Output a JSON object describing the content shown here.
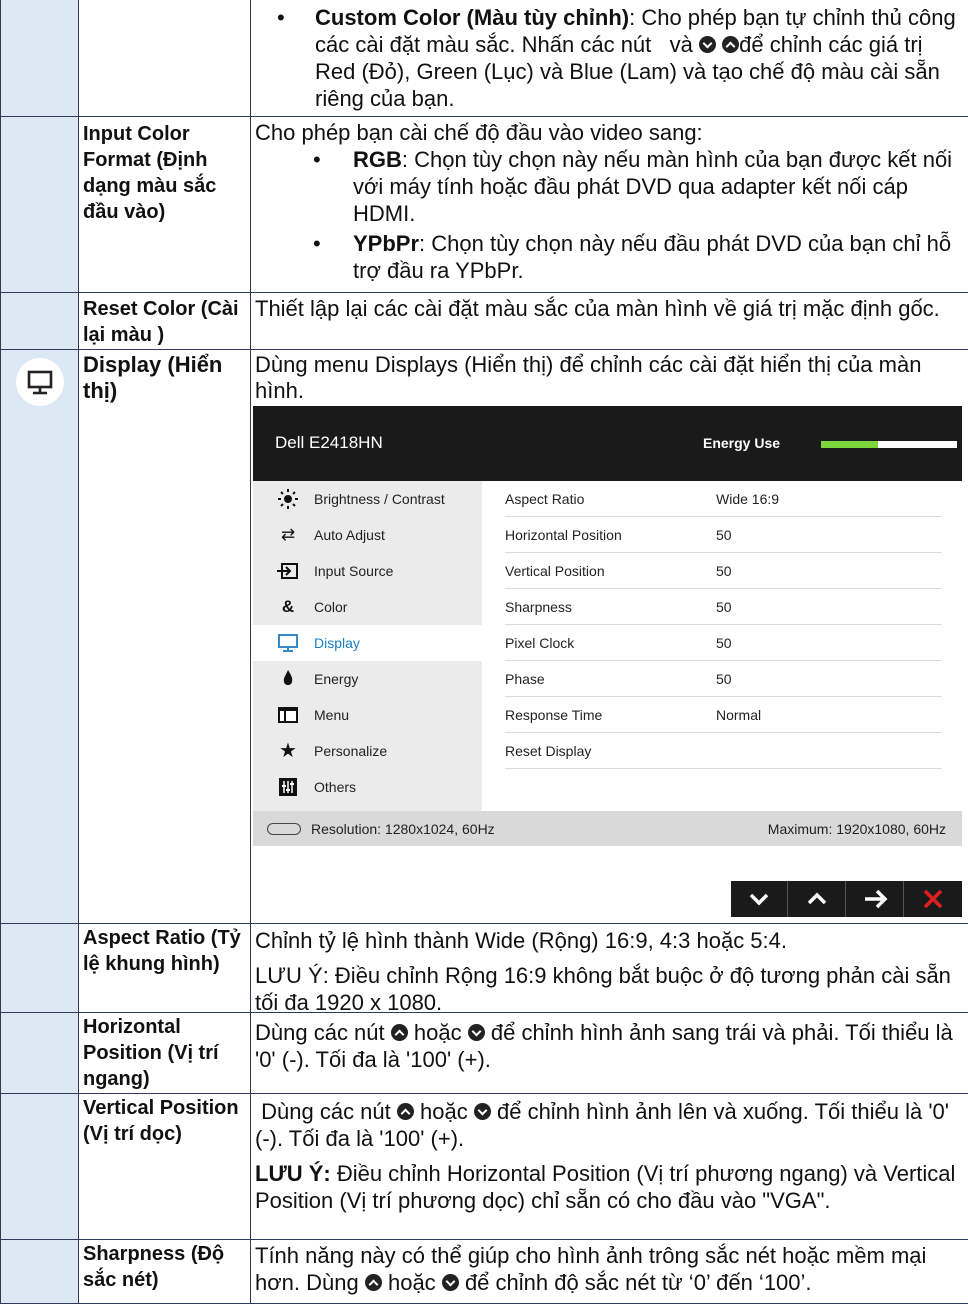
{
  "rows": {
    "custom_color": {
      "bullet": "•",
      "bold": "Custom Color (Màu tùy chỉnh)",
      "text1": ": Cho phép bạn tự chỉnh thủ công các cài đặt màu sắc. Nhấn các nút",
      "text2": "và",
      "text3": "để chỉnh các giá trị Red (Đỏ), Green (Lục) và Blue (Lam) và tạo chế độ màu cài sẵn riêng của bạn."
    },
    "input_color_format": {
      "label": "Input Color Format (Định dạng màu sắc đầu vào)",
      "intro": "Cho phép bạn cài chế độ đầu vào video sang:",
      "bullet": "•",
      "rgb_bold": "RGB",
      "rgb_text": ": Chọn tùy chọn này nếu màn hình của bạn được kết nối với máy tính hoặc đầu phát DVD qua adapter kết nối cáp HDMI.",
      "ypbpr_bold": "YPbPr",
      "ypbpr_text": ": Chọn tùy chọn này nếu đầu phát DVD của bạn chỉ hỗ trợ đầu ra YPbPr."
    },
    "reset_color": {
      "label": "Reset Color (Cài lại màu )",
      "text": "Thiết lập lại các cài đặt màu sắc của màn hình về giá trị mặc định gốc."
    },
    "display": {
      "label": "Display (Hiển thị)",
      "text": "Dùng menu Displays (Hiển thị) để chỉnh các cài đặt hiển thị của màn hình."
    },
    "aspect_ratio": {
      "label": "Aspect Ratio (Tỷ lệ khung hình)",
      "text": "Chỉnh tỷ lệ hình thành Wide (Rộng) 16:9, 4:3 hoặc 5:4.",
      "note": "LƯU Ý: Điều chỉnh Rộng 16:9 không bắt buộc ở độ tương phản cài sẵn tối đa 1920 x 1080."
    },
    "horizontal_position": {
      "label": "Horizontal Position (Vị trí ngang)",
      "text1": "Dùng các nút",
      "text2": "hoặc",
      "text3": "để chỉnh hình ảnh sang trái và phải. Tối thiểu là '0' (-). Tối đa là '100' (+)."
    },
    "vertical_position": {
      "label": "Vertical Position (Vị trí dọc)",
      "text1": "Dùng các nút",
      "text2": "hoặc",
      "text3": "để chỉnh hình ảnh lên và xuống. Tối thiểu là '0' (-). Tối đa là '100' (+).",
      "note_bold": "LƯU Ý:",
      "note_text": "Điều chỉnh Horizontal Position (Vị trí phương ngang) và Vertical Position (Vị trí phương dọc) chỉ sẵn có cho đầu vào \"VGA\"."
    },
    "sharpness": {
      "label": "Sharpness (Độ sắc nét)",
      "text1": "Tính năng này có thể giúp cho hình ảnh trông sắc nét hoặc mềm mại hơn. Dùng",
      "text2": "hoặc",
      "text3": "để chỉnh độ sắc nét từ ‘0’ đến ‘100’."
    }
  },
  "osd": {
    "title": "Dell E2418HN",
    "energy_label": "Energy Use",
    "energy_level": 0.42,
    "energy_color": "#7cd63c",
    "menu": [
      {
        "label": "Brightness / Contrast",
        "icon": "brightness-icon"
      },
      {
        "label": "Auto Adjust",
        "icon": "auto-adjust-icon"
      },
      {
        "label": "Input Source",
        "icon": "input-source-icon"
      },
      {
        "label": "Color",
        "icon": "color-icon"
      },
      {
        "label": "Display",
        "icon": "display-icon"
      },
      {
        "label": "Energy",
        "icon": "energy-icon"
      },
      {
        "label": "Menu",
        "icon": "menu-icon"
      },
      {
        "label": "Personalize",
        "icon": "personalize-icon"
      },
      {
        "label": "Others",
        "icon": "others-icon"
      }
    ],
    "settings": [
      {
        "key": "Aspect Ratio",
        "value": "Wide 16:9"
      },
      {
        "key": "Horizontal Position",
        "value": "50"
      },
      {
        "key": "Vertical Position",
        "value": "50"
      },
      {
        "key": "Sharpness",
        "value": "50"
      },
      {
        "key": "Pixel Clock",
        "value": "50"
      },
      {
        "key": "Phase",
        "value": "50"
      },
      {
        "key": "Response Time",
        "value": "Normal"
      },
      {
        "key": "Reset Display",
        "value": ""
      }
    ],
    "resolution": "Resolution: 1280x1024, 60Hz",
    "maximum": "Maximum: 1920x1080, 60Hz",
    "active_color": "#1b7fc4"
  },
  "buttons": [
    "chevron-down-icon",
    "chevron-up-icon",
    "arrow-right-icon",
    "close-icon"
  ]
}
